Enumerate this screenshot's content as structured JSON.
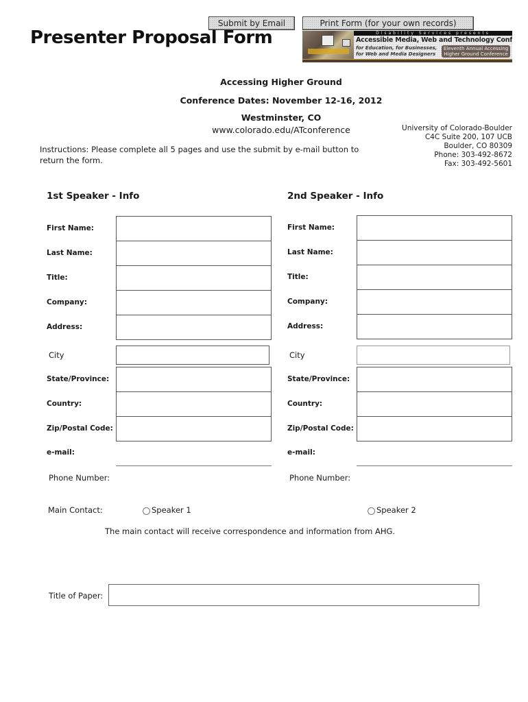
{
  "toolbar": {
    "submit_label": "Submit by Email",
    "print_label": "Print Form (for your own records)"
  },
  "page_title": "Presenter Proposal Form",
  "banner": {
    "top_text": "Disability Services presents",
    "conference_name": "Accessible Media, Web and Technology Conference",
    "subtitle_1": "for Education, for Businesses,",
    "subtitle_2": "for Web and Media Designers",
    "badge_line_1": "Eleventh Annual Accessing",
    "badge_line_2": "Higher Ground Conference"
  },
  "header": {
    "conference": "Accessing Higher Ground",
    "dates": "Conference Dates: November 12-16, 2012",
    "location": "Westminster, CO",
    "website": "www.colorado.edu/ATconference"
  },
  "address": {
    "line1": "University of Colorado-Boulder",
    "line2": "C4C Suite 200, 107 UCB",
    "line3": "Boulder, CO  80309",
    "phone": "Phone: 303-492-8672",
    "fax": "Fax: 303-492-5601"
  },
  "instructions": "Instructions: Please complete all 5 pages and use the submit by e-mail button to return the form.",
  "speaker1": {
    "title": "1st Speaker - Info",
    "first_name": "First Name:",
    "last_name": "Last Name:",
    "title_label": "Title:",
    "company": "Company:",
    "address": "Address:",
    "city": "City",
    "state": "State/Province:",
    "country": "Country:",
    "zip": "Zip/Postal Code:",
    "email": "e-mail:",
    "phone": "Phone Number:"
  },
  "speaker2": {
    "title": "2nd Speaker - Info",
    "first_name": "First Name:",
    "last_name": "Last Name:",
    "title_label": "Title:",
    "company": "Company:",
    "address": "Address:",
    "city": "City",
    "state": "State/Province:",
    "country": "Country:",
    "zip": "Zip/Postal Code:",
    "email": "e-mail:",
    "phone": "Phone Number:"
  },
  "main_contact": {
    "label": "Main Contact:",
    "option1": "Speaker 1",
    "option2": "Speaker 2",
    "note": "The main contact will receive correspondence and information from AHG."
  },
  "paper": {
    "label": "Title of Paper:"
  }
}
